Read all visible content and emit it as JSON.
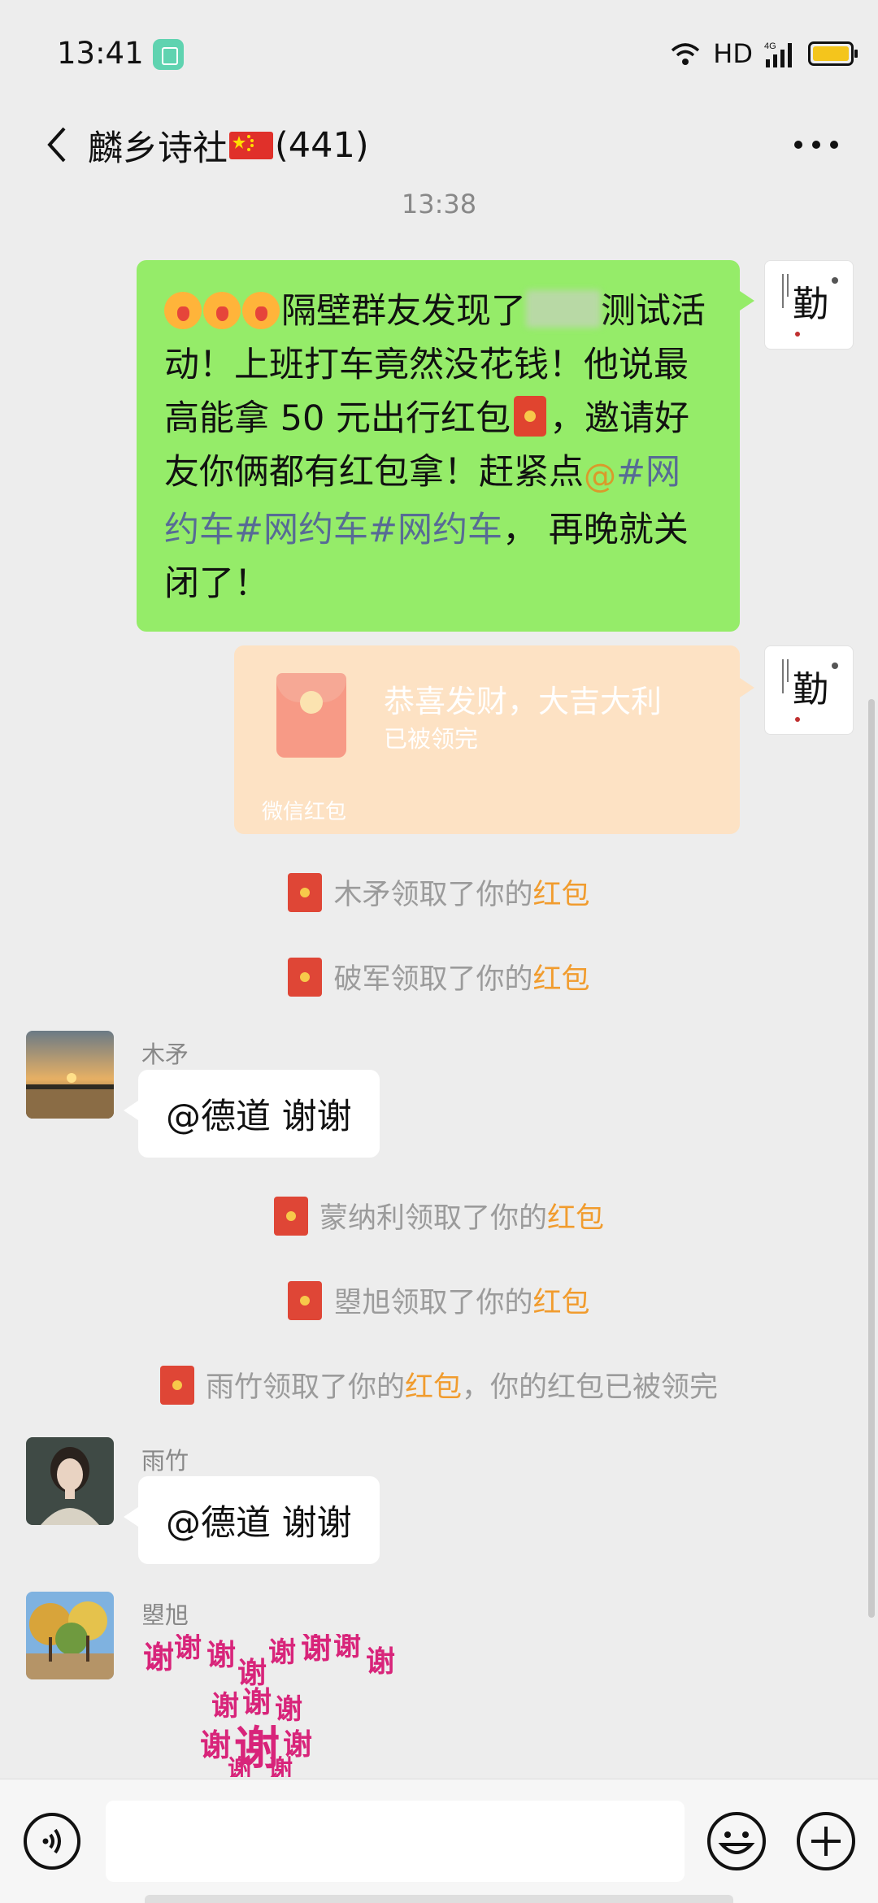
{
  "status_bar": {
    "time": "13:41",
    "network": "HD",
    "signal_badge": "4G"
  },
  "chat": {
    "title": "麟乡诗社",
    "member_count": "(441)"
  },
  "timestamp": "13:38",
  "my_message": {
    "seg1": "隔壁群友发现了",
    "seg2": "测试活动！上班打车竟然没花钱！他说最高能拿 50 元出行红包",
    "seg3": "，邀请好友你俩都有红包拿！赶紧点",
    "hashtags": "#网约车#网约车#网约车",
    "seg4": "， 再晚就关闭了！"
  },
  "red_packet": {
    "title": "恭喜发财，大吉大利",
    "status": "已被领完",
    "footer": "微信红包"
  },
  "system_messages": [
    {
      "prefix": "木矛领取了你的",
      "link": "红包",
      "suffix": ""
    },
    {
      "prefix": "破军领取了你的",
      "link": "红包",
      "suffix": ""
    },
    {
      "prefix": "蒙纳利领取了你的",
      "link": "红包",
      "suffix": ""
    },
    {
      "prefix": "曌旭领取了你的",
      "link": "红包",
      "suffix": ""
    },
    {
      "prefix": "雨竹领取了你的",
      "link": "红包",
      "suffix": "，你的红包已被领完"
    }
  ],
  "messages": [
    {
      "sender": "木矛",
      "text": "@德道  谢谢"
    },
    {
      "sender": "雨竹",
      "text": "@德道  谢谢"
    },
    {
      "sender": "曌旭"
    }
  ],
  "sticker": {
    "text": "谢谢谢谢谢谢谢谢谢谢谢谢谢谢谢谢"
  },
  "colors": {
    "background": "#ededed",
    "my_bubble": "#95ec69",
    "red_packet_received": "#fde2c4",
    "link_orange": "#f19c2e",
    "hashtag_blue": "#576b95"
  }
}
